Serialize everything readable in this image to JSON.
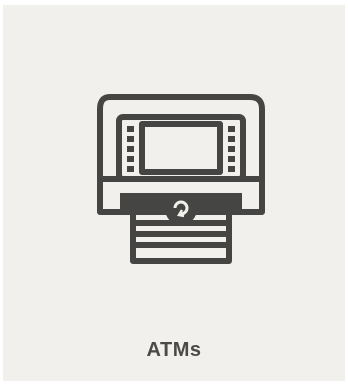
{
  "tile": {
    "label": "ATMs",
    "icon": "atm-machine-icon",
    "background_color": "#f1f0ec",
    "icon_color": "#454543"
  }
}
